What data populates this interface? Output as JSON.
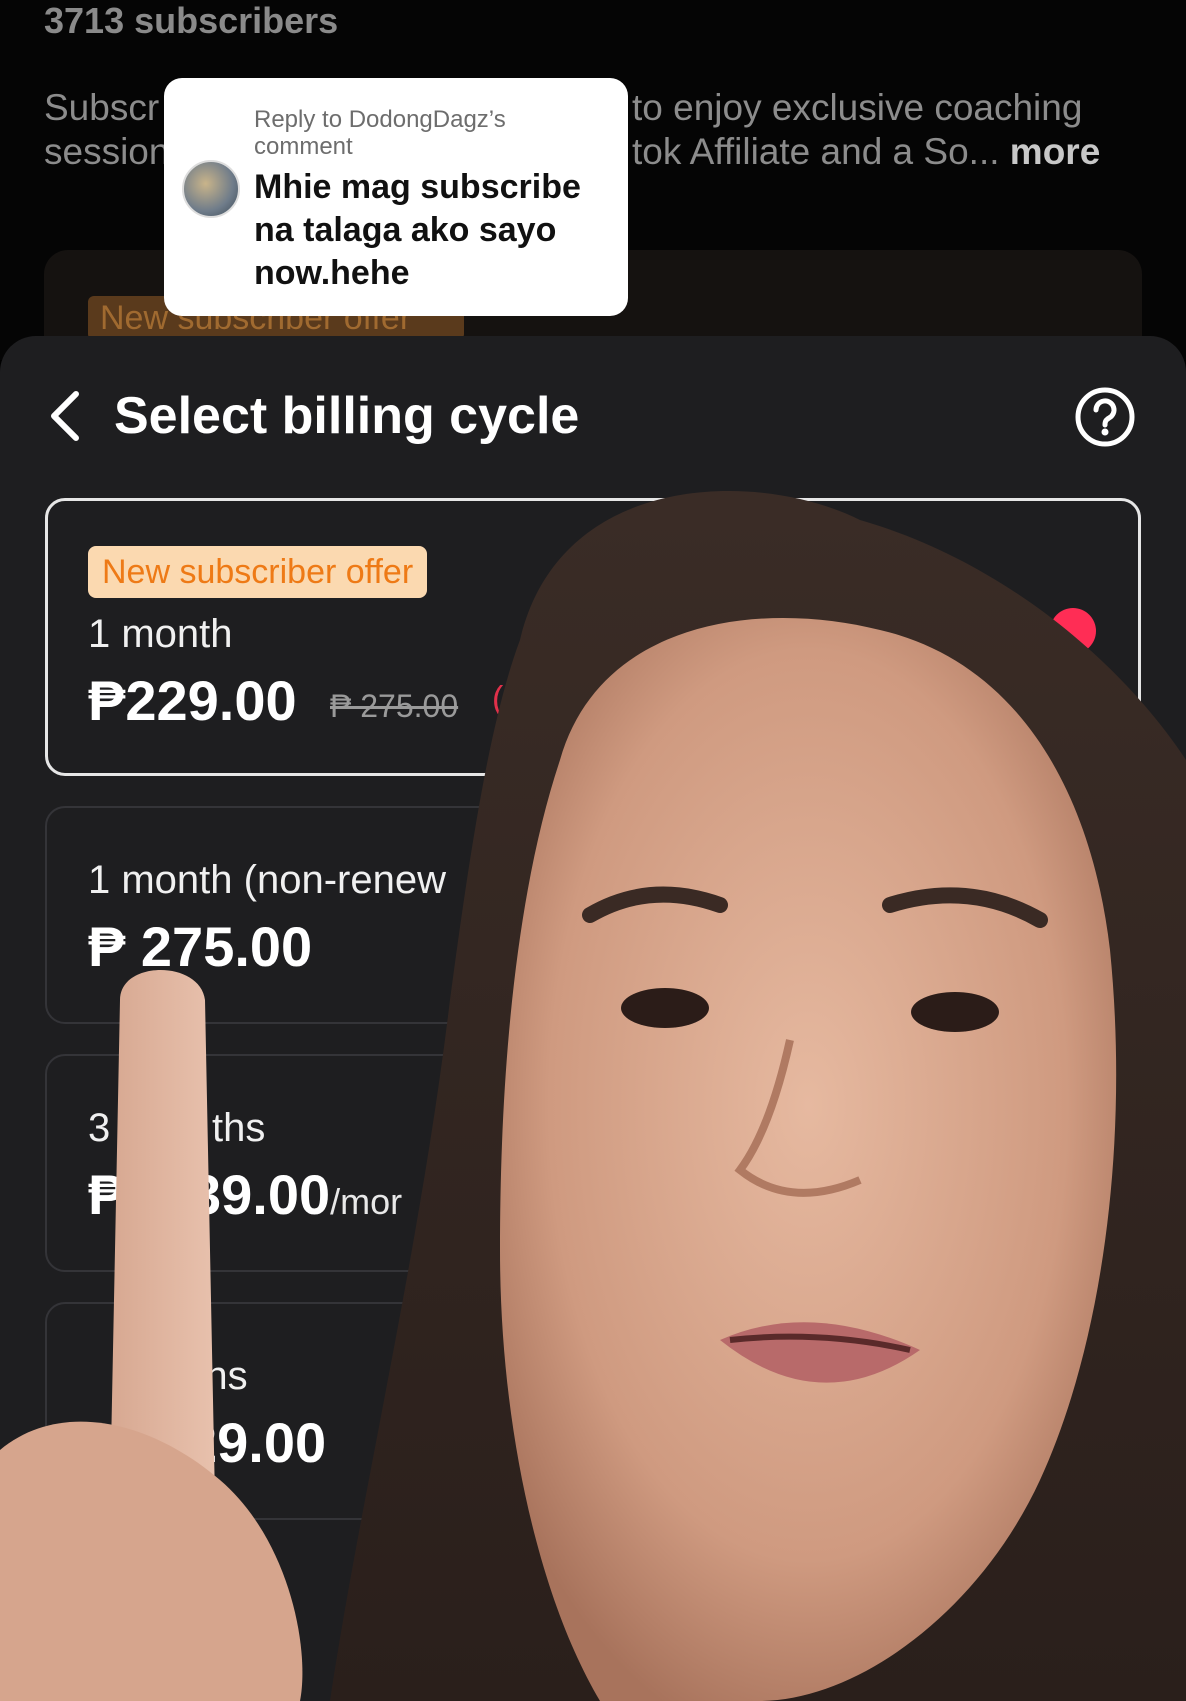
{
  "profile": {
    "subscriber_count": "3713 subscribers",
    "description_left_line1": "Subscr",
    "description_left_line2": "session",
    "description_right_line1": "to enjoy exclusive coaching",
    "description_right_line2": "tok Affiliate and a So...",
    "more_label": "more"
  },
  "background_offer_chip": "New subscriber offer",
  "reply": {
    "reply_to": "Reply to DodongDagz’s comment",
    "text": "Mhie mag subscribe na talaga ako sayo now.hehe"
  },
  "sheet": {
    "title": "Select billing cycle",
    "back_icon": "chevron-left-icon",
    "help_icon": "question-circle-icon"
  },
  "plans": [
    {
      "offer_badge": "New subscriber offer",
      "label": "1 month",
      "price": "₱229.00",
      "old_price": "₱ 275.00",
      "discount": "(15",
      "selected": true
    },
    {
      "label": "1 month (non-renew",
      "price": "₱ 275.00"
    },
    {
      "label_a": "3",
      "label_b": "ths",
      "price_a": "₱",
      "price_b": "39.00",
      "per": "/mor"
    },
    {
      "label": "nths",
      "price": "29.00"
    }
  ],
  "colors": {
    "offer_orange": "#ee7a16",
    "offer_chip_bg": "#fbd9b0",
    "discount_red": "#e0304a",
    "selected_radio": "#ff2d55",
    "sheet_bg": "#1e1e20"
  }
}
